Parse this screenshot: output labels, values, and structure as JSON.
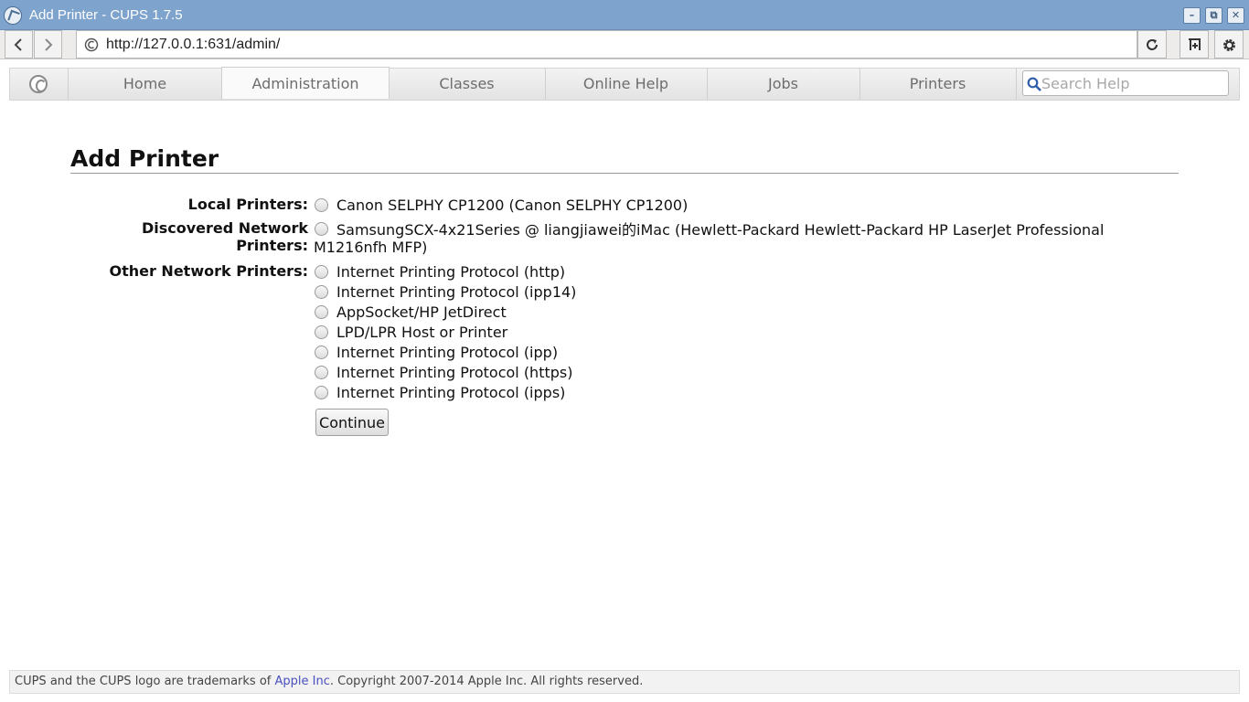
{
  "window": {
    "title": "Add Printer - CUPS 1.7.5",
    "buttons": [
      "–",
      "⧉",
      "✕"
    ]
  },
  "browser": {
    "url": "http://127.0.0.1:631/admin/"
  },
  "nav": {
    "tabs": [
      {
        "label": "Home"
      },
      {
        "label": "Administration",
        "active": true
      },
      {
        "label": "Classes"
      },
      {
        "label": "Online Help"
      },
      {
        "label": "Jobs"
      },
      {
        "label": "Printers"
      }
    ],
    "search_placeholder": "Search Help"
  },
  "main": {
    "title": "Add Printer",
    "local_label": "Local Printers:",
    "local_printers": [
      "Canon SELPHY CP1200 (Canon SELPHY CP1200)"
    ],
    "discovered_label_line1": "Discovered Network",
    "discovered_label_line2": "Printers:",
    "discovered_printers": [
      "SamsungSCX-4x21Series @ liangjiawei的iMac (Hewlett-Packard Hewlett-Packard HP LaserJet Professional M1216nfh MFP)"
    ],
    "other_label": "Other Network Printers:",
    "other_printers": [
      "Internet Printing Protocol (http)",
      "Internet Printing Protocol (ipp14)",
      "AppSocket/HP JetDirect",
      "LPD/LPR Host or Printer",
      "Internet Printing Protocol (ipp)",
      "Internet Printing Protocol (https)",
      "Internet Printing Protocol (ipps)"
    ],
    "continue_label": "Continue"
  },
  "footer": {
    "prefix": "CUPS and the CUPS logo are trademarks of ",
    "link": "Apple Inc",
    "suffix": ". Copyright 2007-2014 Apple Inc. All rights reserved."
  },
  "colors": {
    "titlebar": "#7ea3cc",
    "link": "#4a4fbf"
  }
}
